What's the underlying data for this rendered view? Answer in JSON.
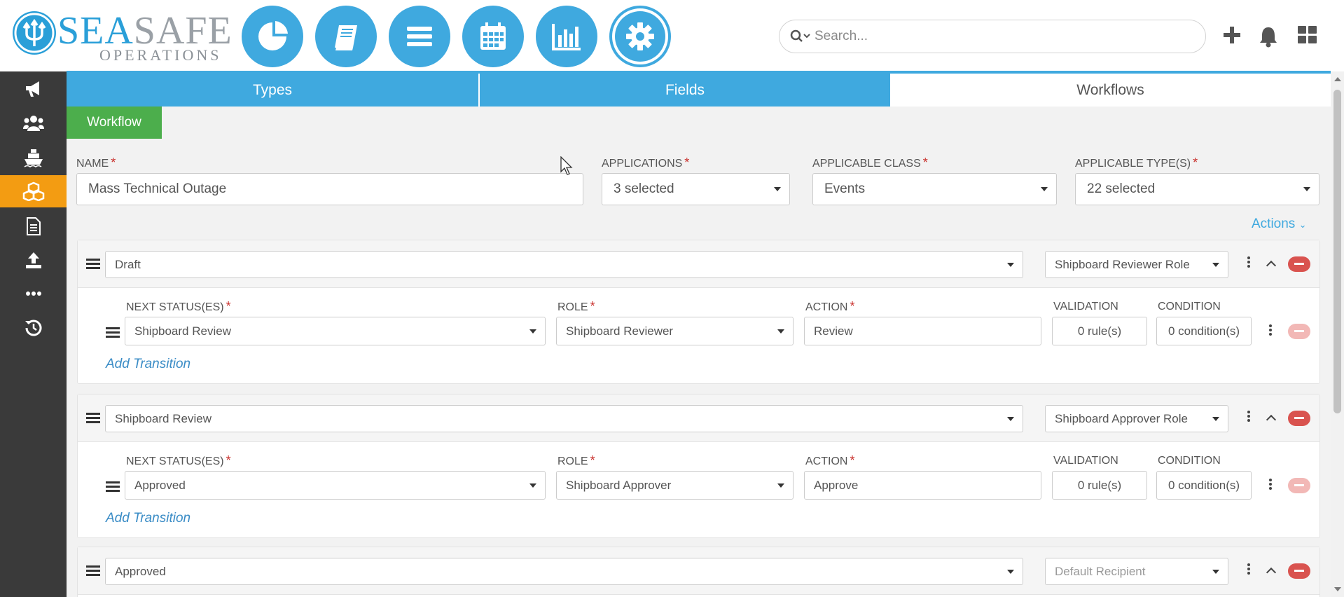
{
  "brand": {
    "name_part1": "SEA",
    "name_part2": "SAFE",
    "subtitle": "OPERATIONS",
    "primary_color": "#3fa9df",
    "accent_color": "#f39c12",
    "success_color": "#4cae4c",
    "danger_color": "#d9534f"
  },
  "top_nav": [
    {
      "icon": "pie-chart-icon"
    },
    {
      "icon": "book-icon"
    },
    {
      "icon": "list-icon"
    },
    {
      "icon": "calendar-icon"
    },
    {
      "icon": "bar-chart-icon"
    },
    {
      "icon": "gear-icon",
      "active": true
    }
  ],
  "search": {
    "placeholder": "Search..."
  },
  "header_actions": [
    "plus-icon",
    "bell-icon",
    "grid-icon"
  ],
  "sidebar": [
    {
      "icon": "megaphone-icon"
    },
    {
      "icon": "users-icon"
    },
    {
      "icon": "ship-icon"
    },
    {
      "icon": "cubes-icon",
      "active": true
    },
    {
      "icon": "document-icon"
    },
    {
      "icon": "upload-icon"
    },
    {
      "icon": "ellipsis-icon"
    },
    {
      "icon": "history-icon"
    }
  ],
  "tabs": [
    {
      "label": "Types"
    },
    {
      "label": "Fields"
    },
    {
      "label": "Workflows",
      "active": true
    }
  ],
  "section_badge": "Workflow",
  "form": {
    "name_label": "NAME",
    "name_value": "Mass Technical Outage",
    "applications_label": "APPLICATIONS",
    "applications_value": "3 selected",
    "class_label": "APPLICABLE CLASS",
    "class_value": "Events",
    "types_label": "APPLICABLE TYPE(S)",
    "types_value": "22 selected"
  },
  "actions_label": "Actions",
  "columns": {
    "next_status": "NEXT STATUS(ES)",
    "role": "ROLE",
    "action": "ACTION",
    "validation": "VALIDATION",
    "condition": "CONDITION"
  },
  "add_transition_label": "Add Transition",
  "statuses": [
    {
      "status": "Draft",
      "role": "Shipboard Reviewer Role",
      "transition": {
        "next_status": "Shipboard Review",
        "role": "Shipboard Reviewer",
        "action": "Review",
        "validation": "0 rule(s)",
        "condition": "0 condition(s)"
      }
    },
    {
      "status": "Shipboard Review",
      "role": "Shipboard Approver Role",
      "transition": {
        "next_status": "Approved",
        "role": "Shipboard Approver",
        "action": "Approve",
        "validation": "0 rule(s)",
        "condition": "0 condition(s)"
      }
    },
    {
      "status": "Approved",
      "role": "Default Recipient"
    }
  ]
}
